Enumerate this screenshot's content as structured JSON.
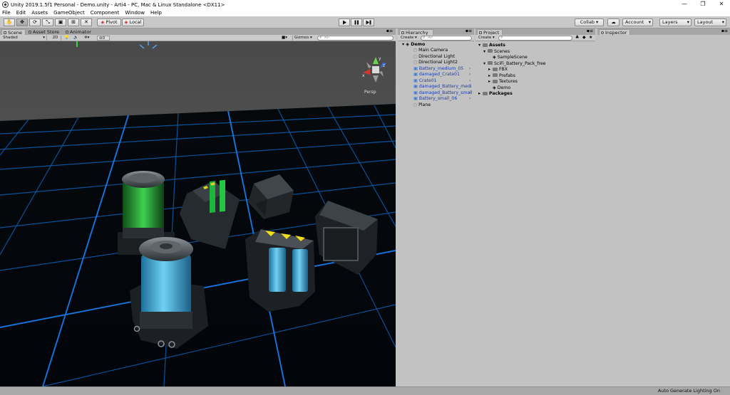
{
  "window": {
    "title": "Unity 2019.1.5f1 Personal - Demo.unity - Arti4 - PC, Mac & Linux Standalone <DX11>",
    "controls": [
      "—",
      "❐",
      "✕"
    ]
  },
  "menu": [
    "File",
    "Edit",
    "Assets",
    "GameObject",
    "Component",
    "Window",
    "Help"
  ],
  "toolbar": {
    "pivot_label": "Pivot",
    "local_label": "Local",
    "collab_label": "Collab ▾",
    "account_label": "Account",
    "layers_label": "Layers",
    "layout_label": "Layout"
  },
  "scene": {
    "tabs": [
      "Scene",
      "Asset Store",
      "Animator"
    ],
    "shading_mode": "Shaded",
    "mode_2d": "2D",
    "hidden_count": "0",
    "gizmos_label": "Gizmos",
    "search_placeholder": "All",
    "persp_label": "Persp",
    "axis_labels": {
      "x": "x",
      "y": "y",
      "z": "z"
    }
  },
  "hierarchy": {
    "tab_label": "Hierarchy",
    "create_label": "Create",
    "search_placeholder": "All",
    "scene_name": "Demo",
    "items": [
      {
        "label": "Main Camera",
        "prefab": false,
        "expandable": false
      },
      {
        "label": "Directional Light",
        "prefab": false,
        "expandable": false
      },
      {
        "label": "Directional Light2",
        "prefab": false,
        "expandable": false
      },
      {
        "label": "Battery_medium_05",
        "prefab": true,
        "expandable": true
      },
      {
        "label": "damaged_Crate01",
        "prefab": true,
        "expandable": true
      },
      {
        "label": "Crate01",
        "prefab": true,
        "expandable": true
      },
      {
        "label": "damaged_Battery_medi",
        "prefab": true,
        "expandable": true
      },
      {
        "label": "damaged_Battery_small",
        "prefab": true,
        "expandable": true
      },
      {
        "label": "Battery_small_06",
        "prefab": true,
        "expandable": true
      },
      {
        "label": "Plane",
        "prefab": false,
        "expandable": false
      }
    ]
  },
  "project": {
    "tab_label": "Project",
    "create_label": "Create",
    "tree": [
      {
        "label": "Assets",
        "depth": 0,
        "bold": true,
        "icon": "folder-open-icon"
      },
      {
        "label": "Scenes",
        "depth": 1,
        "bold": false,
        "icon": "folder-open-icon"
      },
      {
        "label": "SampleScene",
        "depth": 2,
        "bold": false,
        "icon": "unity-scene-icon"
      },
      {
        "label": "SciFi_Battery_Pack_free",
        "depth": 1,
        "bold": false,
        "icon": "folder-open-icon"
      },
      {
        "label": "FBX",
        "depth": 2,
        "bold": false,
        "icon": "folder-icon"
      },
      {
        "label": "Prefabs",
        "depth": 2,
        "bold": false,
        "icon": "folder-icon"
      },
      {
        "label": "Textures",
        "depth": 2,
        "bold": false,
        "icon": "folder-icon"
      },
      {
        "label": "Demo",
        "depth": 2,
        "bold": false,
        "icon": "unity-scene-icon"
      },
      {
        "label": "Packages",
        "depth": 0,
        "bold": true,
        "icon": "folder-icon"
      }
    ]
  },
  "inspector": {
    "tab_label": "Inspector"
  },
  "status": {
    "text": "Auto Generate Lighting On"
  }
}
